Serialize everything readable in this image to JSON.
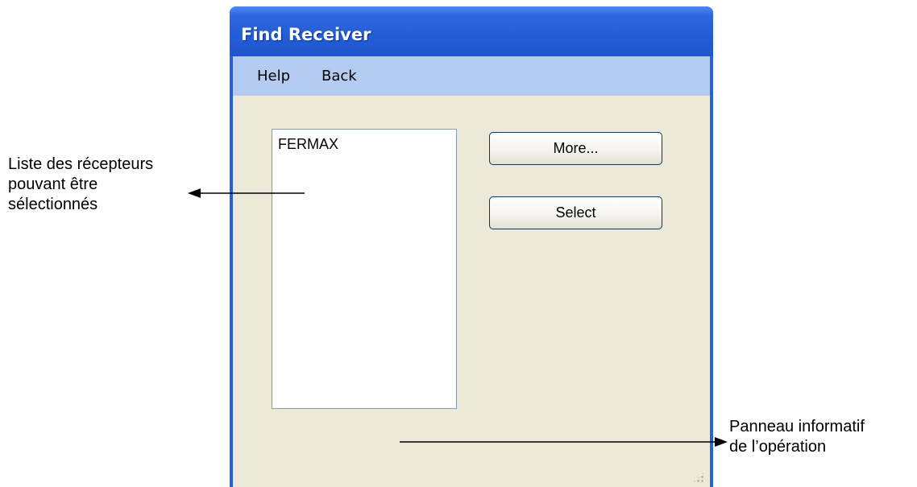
{
  "window": {
    "title": "Find Receiver",
    "menu": [
      "Help",
      "Back"
    ]
  },
  "receiver_list": {
    "items": [
      "FERMAX"
    ]
  },
  "buttons": {
    "more": "More...",
    "select": "Select"
  },
  "annotations": {
    "list_label": [
      "Liste des récepteurs",
      "pouvant être",
      "sélectionnés"
    ],
    "panel_label": [
      "Panneau informatif",
      "de l’opération"
    ]
  },
  "colors": {
    "title_bar": "#245ed8",
    "menu_bar": "#b4cbf2",
    "client_background": "#ece9d8",
    "list_border": "#7f9db9",
    "button_border": "#003c74"
  }
}
